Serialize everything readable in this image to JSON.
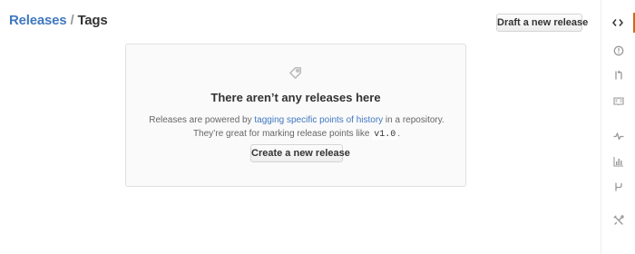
{
  "breadcrumb": {
    "releases": "Releases",
    "separator": "/",
    "tags": "Tags"
  },
  "header": {
    "draft_button": "Draft a new release"
  },
  "blankslate": {
    "icon": "tag-icon",
    "heading": "There aren’t any releases here",
    "desc_before": "Releases are powered by ",
    "desc_link": "tagging specific points of history",
    "desc_after": " in a repository. They’re great for marking release points like ",
    "desc_code": "v1.0",
    "desc_end": ".",
    "create_button": "Create a new release"
  },
  "sidebar": {
    "items": [
      {
        "icon": "code-icon",
        "active": true
      },
      {
        "icon": "issue-opened-icon",
        "active": false
      },
      {
        "icon": "pull-request-icon",
        "active": false
      },
      {
        "icon": "book-icon",
        "active": false
      },
      {
        "icon": "pulse-icon",
        "active": false
      },
      {
        "icon": "graph-icon",
        "active": false
      },
      {
        "icon": "branch-icon",
        "active": false
      },
      {
        "icon": "tools-icon",
        "active": false
      }
    ]
  },
  "colors": {
    "link": "#4078c0",
    "active_indicator": "#d26911",
    "icon": "#999999"
  }
}
